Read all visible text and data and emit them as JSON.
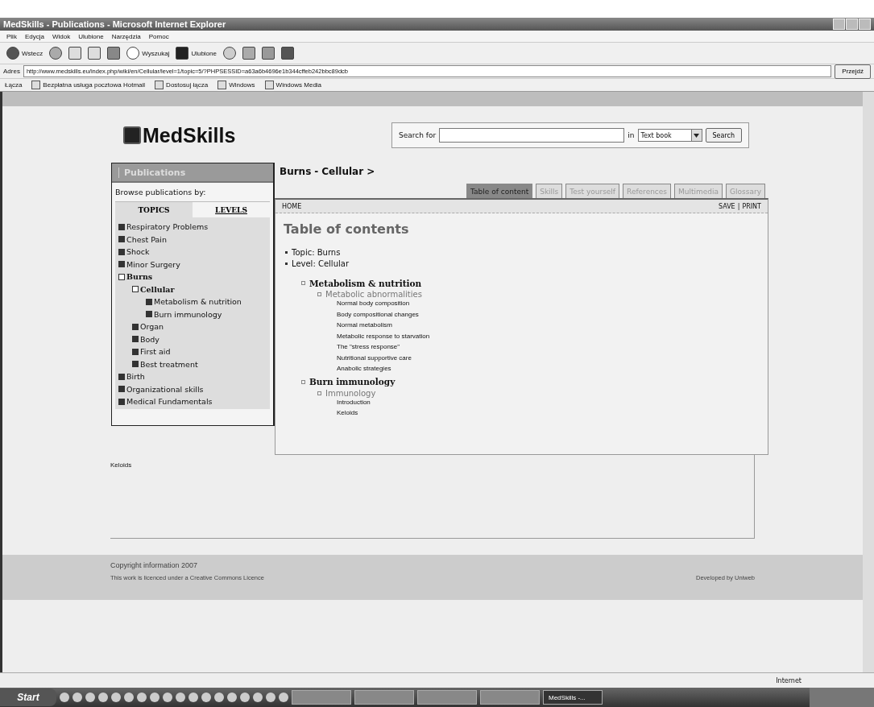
{
  "window": {
    "title": "MedSkills - Publications - Microsoft Internet Explorer"
  },
  "menu": [
    "Plik",
    "Edycja",
    "Widok",
    "Ulubione",
    "Narzędzia",
    "Pomoc"
  ],
  "toolbar": {
    "back": "Wstecz",
    "search": "Wyszukaj",
    "favorites": "Ulubione"
  },
  "address": {
    "label": "Adres",
    "value": "http://www.medskills.eu/index.php/wiki/en/Cellular/level=1/topic=5/?PHPSESSID=a63a6b4696e1b344cffeb242bbc89dcb",
    "go": "Przejdź"
  },
  "links": {
    "label": "Łącza",
    "items": [
      "Bezpłatna usługa pocztowa Hotmail",
      "Dostosuj łącza",
      "Windows",
      "Windows Media"
    ]
  },
  "site": {
    "logo": "MedSkills",
    "search": {
      "label": "Search for",
      "in_label": "in",
      "scope": "Text book",
      "button": "Search"
    },
    "sidebar": {
      "title": "Publications",
      "browse_label": "Browse publications by:",
      "tabs": [
        {
          "label": "TOPICS",
          "selected": true
        },
        {
          "label": "LEVELS",
          "selected": false
        }
      ],
      "tree": [
        {
          "label": "Respiratory Problems",
          "expanded": false
        },
        {
          "label": "Chest Pain",
          "expanded": false
        },
        {
          "label": "Shock",
          "expanded": false
        },
        {
          "label": "Minor Surgery",
          "expanded": false
        },
        {
          "label": "Burns",
          "expanded": true,
          "children": [
            {
              "label": "Cellular",
              "expanded": true,
              "children": [
                {
                  "label": "Metabolism & nutrition",
                  "expanded": false
                },
                {
                  "label": "Burn immunology",
                  "expanded": false
                }
              ]
            },
            {
              "label": "Organ",
              "expanded": false
            },
            {
              "label": "Body",
              "expanded": false
            },
            {
              "label": "First aid",
              "expanded": false
            },
            {
              "label": "Best treatment",
              "expanded": false
            }
          ]
        },
        {
          "label": "Birth",
          "expanded": false
        },
        {
          "label": "Organizational skills",
          "expanded": false
        },
        {
          "label": "Medical Fundamentals",
          "expanded": false
        }
      ]
    },
    "breadcrumb": [
      "Burns",
      "-",
      "Cellular",
      ">"
    ],
    "tabs": [
      {
        "label": "Table of content",
        "selected": true
      },
      {
        "label": "Skills",
        "selected": false
      },
      {
        "label": "Test yourself",
        "selected": false
      },
      {
        "label": "References",
        "selected": false
      },
      {
        "label": "Multimedia",
        "selected": false
      },
      {
        "label": "Glossary",
        "selected": false
      }
    ],
    "actions": {
      "home": "HOME",
      "save": "SAVE",
      "separator": "|",
      "print": "PRINT"
    },
    "content": {
      "heading": "Table of contents",
      "facts": [
        "Topic: Burns",
        "Level: Cellular"
      ],
      "sections": [
        {
          "title": "Metabolism & nutrition",
          "subsections": [
            {
              "title": "Metabolic abnormalities",
              "items": [
                "Normal body composition",
                "Body compositional changes",
                "Normal metabolism",
                "Metabolic response to starvation",
                "The \"stress response\"",
                "Nutritional supportive care",
                "Anabolic strategies"
              ]
            }
          ]
        },
        {
          "title": "Burn immunology",
          "subsections": [
            {
              "title": "Immunology",
              "items": [
                "Introduction",
                "Keloids"
              ]
            }
          ]
        }
      ]
    },
    "below_text": "Keloids",
    "footer": {
      "copyright": "Copyright information 2007",
      "licence": "This work is licenced under a Creative Commons Licence",
      "developer": "Developed by Uniweb"
    }
  },
  "status_bar": {
    "zone": "Internet"
  },
  "taskbar": {
    "start": "Start",
    "windows": [
      {
        "selected": false
      },
      {
        "selected": false
      },
      {
        "selected": false
      },
      {
        "selected": false
      },
      {
        "label": "MedSkills -...",
        "selected": true
      }
    ]
  }
}
